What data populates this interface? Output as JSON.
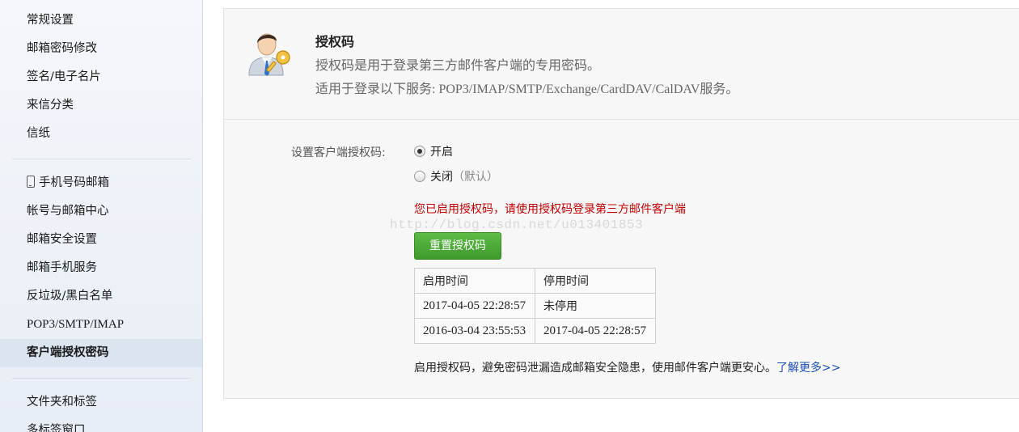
{
  "sidebar": {
    "items": [
      {
        "label": "常规设置"
      },
      {
        "label": "邮箱密码修改"
      },
      {
        "label": "签名/电子名片"
      },
      {
        "label": "来信分类"
      },
      {
        "label": "信纸"
      },
      {
        "label": "手机号码邮箱",
        "icon": "phone-icon"
      },
      {
        "label": "帐号与邮箱中心"
      },
      {
        "label": "邮箱安全设置"
      },
      {
        "label": "邮箱手机服务"
      },
      {
        "label": "反垃圾/黑白名单"
      },
      {
        "label": "POP3/SMTP/IMAP"
      },
      {
        "label": "客户端授权密码",
        "active": true
      },
      {
        "label": "文件夹和标签"
      },
      {
        "label": "多标签窗口"
      }
    ]
  },
  "header": {
    "title": "授权码",
    "line1": "授权码是用于登录第三方邮件客户端的专用密码。",
    "line2": "适用于登录以下服务: POP3/IMAP/SMTP/Exchange/CardDAV/CalDAV服务。"
  },
  "settings": {
    "label": "设置客户端授权码:",
    "option_on": "开启",
    "option_off": "关闭",
    "option_off_note": "（默认）",
    "selected": "开启"
  },
  "notice": "您已启用授权码，请使用授权码登录第三方邮件客户端",
  "watermark": "http://blog.csdn.net/u013401853",
  "reset_button": "重置授权码",
  "table": {
    "headers": [
      "启用时间",
      "停用时间"
    ],
    "rows": [
      [
        "2017-04-05 22:28:57",
        "未停用"
      ],
      [
        "2016-03-04 23:55:53",
        "2017-04-05 22:28:57"
      ]
    ]
  },
  "footer": {
    "text": "启用授权码，避免密码泄漏造成邮箱安全隐患，使用邮件客户端更安心。",
    "link": "了解更多>>"
  },
  "colors": {
    "notice": "#c00000",
    "button": "#4aa836",
    "link": "#1a4fb5"
  }
}
